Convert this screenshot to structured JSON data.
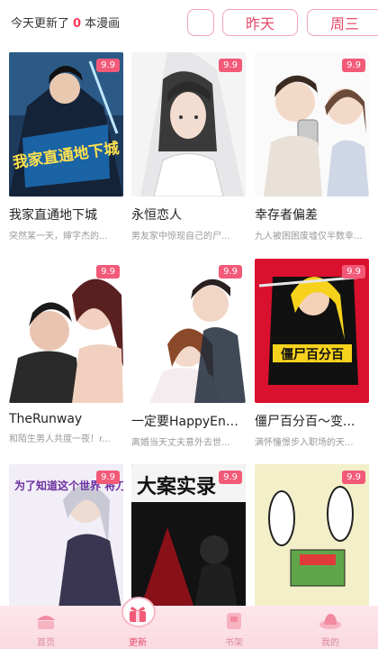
{
  "header": {
    "update_prefix": "今天更新了",
    "update_count": "0",
    "update_suffix": "本漫画",
    "tabs": [
      "昨天",
      "周三"
    ]
  },
  "comics": [
    {
      "title": "我家直通地下城",
      "desc": "突然某一天，婶字杰的...",
      "badge": "9.9",
      "cover_text": "我家直通地下城"
    },
    {
      "title": "永恒恋人",
      "desc": "男友家中惊现自己的尸...",
      "badge": "9.9",
      "cover_text": ""
    },
    {
      "title": "幸存者偏差",
      "desc": "九人被困困废墟仅半数幸...",
      "badge": "9.9",
      "cover_text": ""
    },
    {
      "title": "TheRunway",
      "desc": "和陌生男人共度一夜！r...",
      "badge": "9.9",
      "cover_text": ""
    },
    {
      "title": "一定要HappyEnding",
      "desc": "离婚当天丈夫意外去世...",
      "badge": "9.9",
      "cover_text": ""
    },
    {
      "title": "僵尸百分百～变...",
      "desc": "满怀憧憬步入职场的天...",
      "badge": "9.9",
      "cover_text": "僵尸百分百"
    },
    {
      "title": "",
      "desc": "",
      "badge": "9.9",
      "cover_text": "为了知道这个世界 将刀刃挥舞"
    },
    {
      "title": "",
      "desc": "",
      "badge": "9.9",
      "cover_text": "大案实录"
    },
    {
      "title": "",
      "desc": "",
      "badge": "9.9",
      "cover_text": ""
    }
  ],
  "nav": [
    {
      "label": "首页",
      "icon": "home-icon"
    },
    {
      "label": "更新",
      "icon": "gift-icon"
    },
    {
      "label": "书架",
      "icon": "bookshelf-icon"
    },
    {
      "label": "我的",
      "icon": "hat-icon"
    }
  ],
  "colors": {
    "accent": "#e34a6a",
    "badge": "#f25a78",
    "nav_bg": "#fbd9e1"
  }
}
